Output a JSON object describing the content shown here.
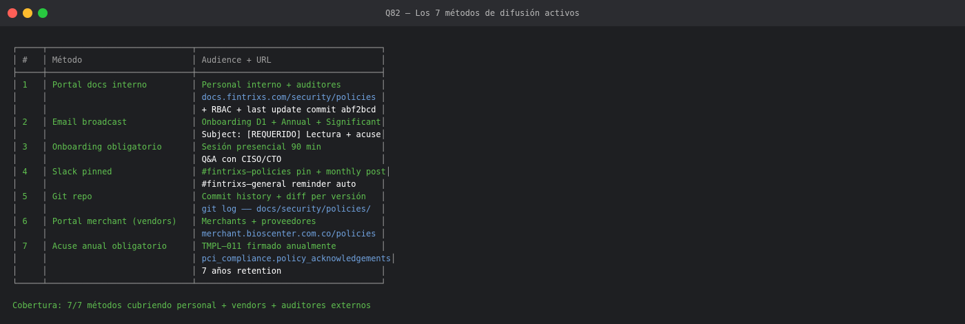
{
  "window": {
    "title": "Q82 — Los 7 métodos de difusión activos"
  },
  "table": {
    "headers": {
      "num": "#",
      "method": "Método",
      "audience": "Audience + URL"
    },
    "rows": [
      {
        "num": "1",
        "method": "Portal docs interno",
        "lines": [
          {
            "text": "Personal interno + auditores",
            "color": "green"
          },
          {
            "text": "docs.fintrixs.com/security/policies",
            "color": "blue"
          },
          {
            "text": "+ RBAC + last update commit abf2bcd",
            "color": "white"
          }
        ]
      },
      {
        "num": "2",
        "method": "Email broadcast",
        "lines": [
          {
            "text": "Onboarding D1 + Annual + Significant",
            "color": "green"
          },
          {
            "text": "Subject: [REQUERIDO] Lectura + acuse",
            "color": "white"
          }
        ]
      },
      {
        "num": "3",
        "method": "Onboarding obligatorio",
        "lines": [
          {
            "text": "Sesión presencial 90 min",
            "color": "green"
          },
          {
            "text": "Q&A con CISO/CTO",
            "color": "white"
          }
        ]
      },
      {
        "num": "4",
        "method": "Slack pinned",
        "lines": [
          {
            "text": "#fintrixs–policies pin + monthly post",
            "color": "green"
          },
          {
            "text": "#fintrixs–general reminder auto",
            "color": "white"
          }
        ]
      },
      {
        "num": "5",
        "method": "Git repo",
        "lines": [
          {
            "text": "Commit history + diff per versión",
            "color": "green"
          },
          {
            "text": "git log –– docs/security/policies/",
            "color": "blue"
          }
        ]
      },
      {
        "num": "6",
        "method": "Portal merchant (vendors)",
        "lines": [
          {
            "text": "Merchants + proveedores",
            "color": "green"
          },
          {
            "text": "merchant.bioscenter.com.co/policies",
            "color": "blue"
          }
        ]
      },
      {
        "num": "7",
        "method": "Acuse anual obligatorio",
        "lines": [
          {
            "text": "TMPL–011 firmado anualmente",
            "color": "green"
          },
          {
            "text": "pci_compliance.policy_acknowledgements",
            "color": "blue"
          },
          {
            "text": "7 años retention",
            "color": "white"
          }
        ]
      }
    ]
  },
  "footer": {
    "text": "Cobertura: 7/7 métodos cubriendo personal + vendors + auditores externos"
  },
  "colors": {
    "background": "#1e1f22",
    "titlebar": "#2b2c30",
    "green": "#5fbf4f",
    "blue": "#6fa0dc",
    "white": "#ffffff",
    "frame": "#a0a0a0"
  }
}
